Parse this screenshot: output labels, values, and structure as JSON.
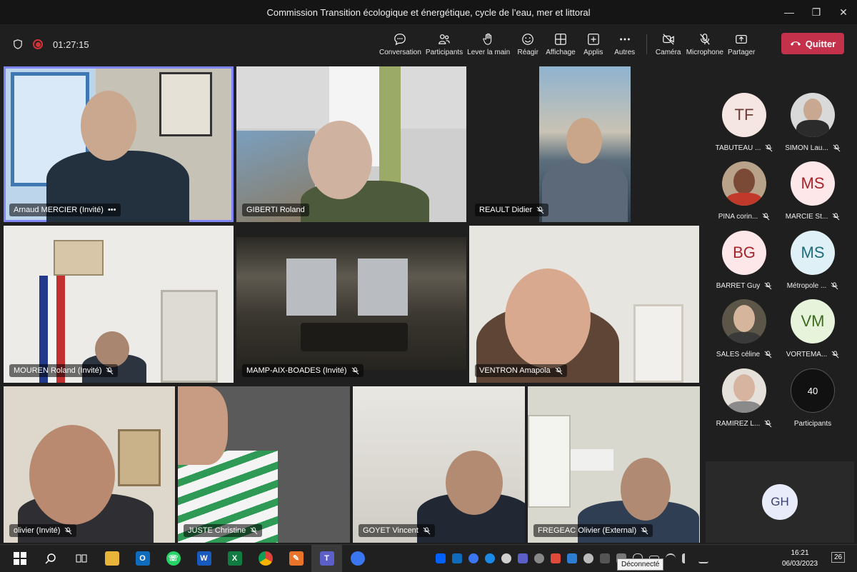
{
  "window": {
    "title": "Commission Transition écologique et énergétique, cycle de l’eau, mer et littoral",
    "minimize": "—",
    "restore": "❐",
    "close": "✕"
  },
  "toolbar": {
    "timer": "01:27:15",
    "actions": [
      {
        "label": "Conversation",
        "icon": "chat-icon"
      },
      {
        "label": "Participants",
        "icon": "people-icon"
      },
      {
        "label": "Lever la main",
        "icon": "hand-icon"
      },
      {
        "label": "Réagir",
        "icon": "smile-icon"
      },
      {
        "label": "Affichage",
        "icon": "grid-icon"
      },
      {
        "label": "Applis",
        "icon": "plus-icon"
      },
      {
        "label": "Autres",
        "icon": "more-icon"
      }
    ],
    "devices": [
      {
        "label": "Caméra",
        "icon": "camera-off-icon"
      },
      {
        "label": "Microphone",
        "icon": "mic-off-icon"
      },
      {
        "label": "Partager",
        "icon": "share-icon"
      }
    ],
    "quit_label": "Quitter",
    "accent": "#c4314b"
  },
  "tiles": [
    {
      "name": "Arnaud MERCIER (Invité)",
      "extra": "•••",
      "muted": false
    },
    {
      "name": "GIBERTI Roland",
      "muted": false
    },
    {
      "name": "REAULT Didier",
      "muted": true
    },
    {
      "name": "MOUREN Roland (Invité)",
      "muted": true
    },
    {
      "name": "MAMP-AIX-BOADES (Invité)",
      "muted": true
    },
    {
      "name": "VENTRON Amapola",
      "muted": true
    },
    {
      "name": "olivier (Invité)",
      "muted": true
    },
    {
      "name": "JUSTE Christine",
      "muted": true
    },
    {
      "name": "GOYET Vincent",
      "muted": true
    },
    {
      "name": "FREGEAC Olivier (External)",
      "muted": true
    }
  ],
  "roster": [
    {
      "initials": "TF",
      "name": "TABUTEAU ...",
      "bg": "#f6e6e3",
      "fg": "#6b3a32"
    },
    {
      "initials": "",
      "name": "SIMON Lau...",
      "bg": "#8a8a8a",
      "fg": "#fff"
    },
    {
      "initials": "",
      "name": "PINA corin...",
      "bg": "#7a5040",
      "fg": "#fff"
    },
    {
      "initials": "MS",
      "name": "MARCIE St...",
      "bg": "#fde7e9",
      "fg": "#a4262c"
    },
    {
      "initials": "BG",
      "name": "BARRET Guy",
      "bg": "#fde7e9",
      "fg": "#a4262c"
    },
    {
      "initials": "MS",
      "name": "Métropole ...",
      "bg": "#dff0f6",
      "fg": "#1e6b7b"
    },
    {
      "initials": "",
      "name": "SALES céline",
      "bg": "#6f6a60",
      "fg": "#fff"
    },
    {
      "initials": "VM",
      "name": "VORTEMA...",
      "bg": "#e8f3dc",
      "fg": "#3b6b1e"
    },
    {
      "initials": "",
      "name": "RAMIREZ L...",
      "bg": "#c9b9ad",
      "fg": "#fff"
    },
    {
      "initials": "40",
      "name": "Participants",
      "bg": "#111",
      "fg": "#fff"
    }
  ],
  "spotlight_tile": {
    "initials": "GH"
  },
  "taskbar": {
    "apps": [
      {
        "name": "windows-start",
        "glyph": "⊞",
        "color": "#3a96dd"
      },
      {
        "name": "search",
        "glyph": "⌕",
        "color": "#202020"
      },
      {
        "name": "task-view",
        "glyph": "▥",
        "color": "#202020"
      },
      {
        "name": "file-explorer",
        "glyph": "▬",
        "color": "#e8b43a"
      },
      {
        "name": "outlook",
        "glyph": "O",
        "color": "#0f6cbd"
      },
      {
        "name": "whatsapp",
        "glyph": "☏",
        "color": "#25d366"
      },
      {
        "name": "word",
        "glyph": "W",
        "color": "#185abd"
      },
      {
        "name": "excel",
        "glyph": "X",
        "color": "#107c41"
      },
      {
        "name": "chrome",
        "glyph": "◉",
        "color": "#db4437"
      },
      {
        "name": "powerpoint-pen",
        "glyph": "✎",
        "color": "#e8742a"
      },
      {
        "name": "teams",
        "glyph": "T",
        "color": "#5b5fc7"
      },
      {
        "name": "signal",
        "glyph": "◌",
        "color": "#3a76f0"
      }
    ],
    "time": "16:21",
    "date": "06/03/2023",
    "notifications": "26",
    "tooltip": "Déconnecté"
  }
}
